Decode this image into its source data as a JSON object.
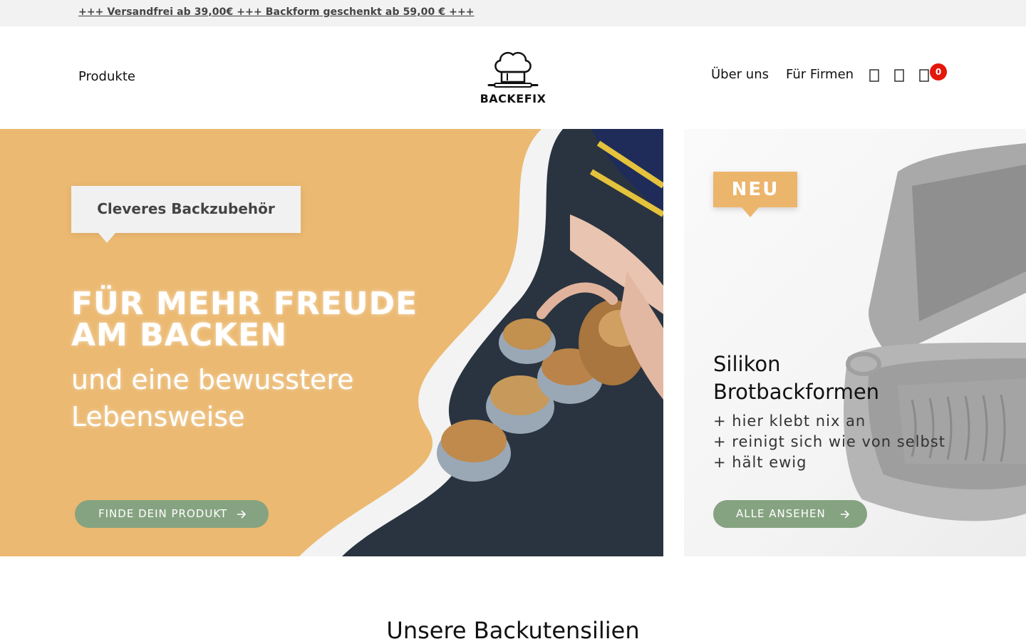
{
  "announcement": {
    "text": "+++ Versandfrei ab 39,00€ +++ Backform geschenkt ab 59,00 € +++"
  },
  "header": {
    "nav_left": "Produkte",
    "logo_text": "BACKEFIX",
    "nav_about": "Über uns",
    "nav_business": "Für Firmen",
    "icons": [
      "search-icon",
      "account-icon",
      "cart-icon"
    ],
    "cart_count": "0"
  },
  "hero_left": {
    "badge": "Cleveres Backzubehör",
    "headline": "FÜR MEHR FREUDE AM BACKEN",
    "subline": "und eine bewusstere Lebensweise",
    "cta": "FINDE DEIN PRODUKT"
  },
  "hero_right": {
    "badge": "NEU",
    "title": "Silikon Brotbackformen",
    "bullets": [
      "+ hier klebt nix an",
      "+ reinigt sich wie von selbst",
      "+ hält ewig"
    ],
    "cta": "ALLE ANSEHEN"
  },
  "section": {
    "title": "Unsere Backutensilien"
  },
  "colors": {
    "accent_orange": "#ebb971",
    "cta_green": "#86a381",
    "badge_red": "#e3170a"
  }
}
